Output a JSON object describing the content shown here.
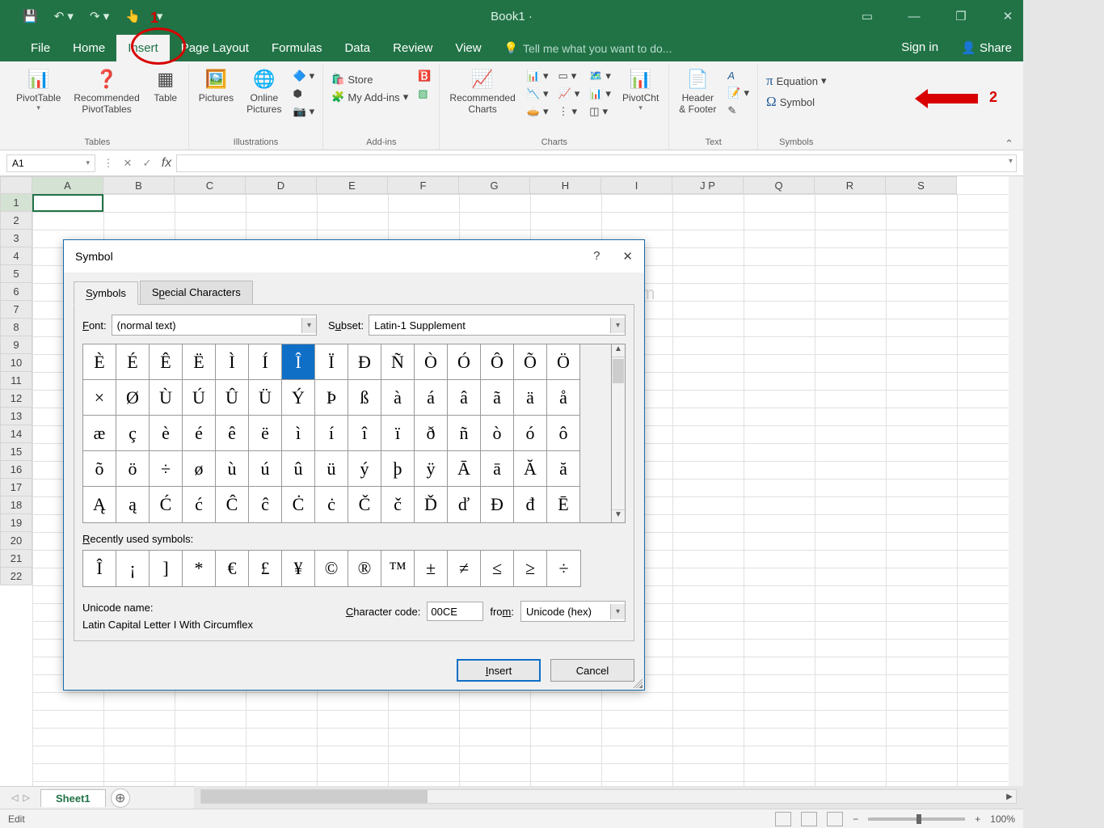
{
  "titlebar": {
    "doc_title": "Book1 ·"
  },
  "tabs": {
    "file": "File",
    "home": "Home",
    "insert": "Insert",
    "page_layout": "Page Layout",
    "formulas": "Formulas",
    "data": "Data",
    "review": "Review",
    "view": "View",
    "tell_me": "Tell me what you want to do...",
    "sign_in": "Sign in",
    "share": "Share"
  },
  "ribbon": {
    "pivot": "PivotTable",
    "rec_pivot": "Recommended\nPivotTables",
    "table": "Table",
    "pictures": "Pictures",
    "online_pic": "Online\nPictures",
    "store": "Store",
    "addins": "My Add-ins",
    "rec_charts": "Recommended\nCharts",
    "pivotcht": "PivotCht",
    "header_footer": "Header\n& Footer",
    "equation": "Equation",
    "symbol": "Symbol",
    "grp_tables": "Tables",
    "grp_illus": "Illustrations",
    "grp_addins": "Add-ins",
    "grp_charts": "Charts",
    "grp_text": "Text",
    "grp_symbols": "Symbols"
  },
  "formula": {
    "namebox": "A1",
    "fx": "fx"
  },
  "grid": {
    "cols": [
      "A",
      "B",
      "C",
      "D",
      "E",
      "F",
      "G",
      "H",
      "I",
      "J P",
      "Q",
      "R",
      "S"
    ],
    "rows": [
      "1",
      "2",
      "3",
      "4",
      "5",
      "6",
      "7",
      "8",
      "9",
      "10",
      "11",
      "12",
      "13",
      "14",
      "15",
      "16",
      "17",
      "18",
      "19",
      "20",
      "21",
      "22"
    ]
  },
  "sheet": {
    "tab1": "Sheet1",
    "add": "+"
  },
  "status": {
    "mode": "Edit",
    "zoom": "100%"
  },
  "annot": {
    "one": "1",
    "two": "2"
  },
  "watermark": "Sitesbay.com",
  "dialog": {
    "title": "Symbol",
    "help": "?",
    "close": "✕",
    "tab_symbols": "Symbols",
    "tab_special": "Special Characters",
    "font_label": "Font:",
    "font_value": "(normal text)",
    "subset_label": "Subset:",
    "subset_value": "Latin-1 Supplement",
    "chars": [
      [
        "È",
        "É",
        "Ê",
        "Ë",
        "Ì",
        "Í",
        "Î",
        "Ï",
        "Ð",
        "Ñ",
        "Ò",
        "Ó",
        "Ô",
        "Õ",
        "Ö"
      ],
      [
        "×",
        "Ø",
        "Ù",
        "Ú",
        "Û",
        "Ü",
        "Ý",
        "Þ",
        "ß",
        "à",
        "á",
        "â",
        "ã",
        "ä",
        "å"
      ],
      [
        "æ",
        "ç",
        "è",
        "é",
        "ê",
        "ë",
        "ì",
        "í",
        "î",
        "ï",
        "ð",
        "ñ",
        "ò",
        "ó",
        "ô"
      ],
      [
        "õ",
        "ö",
        "÷",
        "ø",
        "ù",
        "ú",
        "û",
        "ü",
        "ý",
        "þ",
        "ÿ",
        "Ā",
        "ā",
        "Ă",
        "ă"
      ],
      [
        "Ą",
        "ą",
        "Ć",
        "ć",
        "Ĉ",
        "ĉ",
        "Ċ",
        "ċ",
        "Č",
        "č",
        "Ď",
        "ď",
        "Đ",
        "đ",
        "Ē"
      ]
    ],
    "selected_index": [
      0,
      6
    ],
    "recent_label": "Recently used symbols:",
    "recent": [
      "Î",
      "¡",
      "]",
      "*",
      "€",
      "£",
      "¥",
      "©",
      "®",
      "™",
      "±",
      "≠",
      "≤",
      "≥",
      "÷"
    ],
    "uname_label": "Unicode name:",
    "uname_value": "Latin Capital Letter I With Circumflex",
    "code_label": "Character code:",
    "code_value": "00CE",
    "from_label": "from:",
    "from_value": "Unicode (hex)",
    "btn_insert": "Insert",
    "btn_cancel": "Cancel"
  }
}
